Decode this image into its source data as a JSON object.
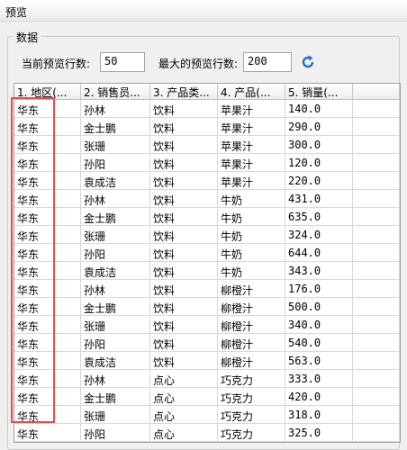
{
  "window": {
    "title": "预览"
  },
  "group": {
    "label": "数据"
  },
  "controls": {
    "current_rows_label": "当前预览行数:",
    "current_rows_value": "50",
    "max_rows_label": "最大的预览行数:",
    "max_rows_value": "200",
    "refresh_icon": "refresh-icon"
  },
  "table": {
    "columns": [
      "1. 地区(...",
      "2. 销售员...",
      "3. 产品类...",
      "4. 产品(...",
      "5. 销量(..."
    ],
    "rows": [
      [
        "华东",
        "孙林",
        "饮料",
        "苹果汁",
        "140.0"
      ],
      [
        "华东",
        "金士鹏",
        "饮料",
        "苹果汁",
        "290.0"
      ],
      [
        "华东",
        "张珊",
        "饮料",
        "苹果汁",
        "300.0"
      ],
      [
        "华东",
        "孙阳",
        "饮料",
        "苹果汁",
        "120.0"
      ],
      [
        "华东",
        "袁成洁",
        "饮料",
        "苹果汁",
        "220.0"
      ],
      [
        "华东",
        "孙林",
        "饮料",
        "牛奶",
        "431.0"
      ],
      [
        "华东",
        "金士鹏",
        "饮料",
        "牛奶",
        "635.0"
      ],
      [
        "华东",
        "张珊",
        "饮料",
        "牛奶",
        "324.0"
      ],
      [
        "华东",
        "孙阳",
        "饮料",
        "牛奶",
        "644.0"
      ],
      [
        "华东",
        "袁成洁",
        "饮料",
        "牛奶",
        "343.0"
      ],
      [
        "华东",
        "孙林",
        "饮料",
        "柳橙汁",
        "176.0"
      ],
      [
        "华东",
        "金士鹏",
        "饮料",
        "柳橙汁",
        "500.0"
      ],
      [
        "华东",
        "张珊",
        "饮料",
        "柳橙汁",
        "340.0"
      ],
      [
        "华东",
        "孙阳",
        "饮料",
        "柳橙汁",
        "540.0"
      ],
      [
        "华东",
        "袁成洁",
        "饮料",
        "柳橙汁",
        "563.0"
      ],
      [
        "华东",
        "孙林",
        "点心",
        "巧克力",
        "333.0"
      ],
      [
        "华东",
        "金士鹏",
        "点心",
        "巧克力",
        "420.0"
      ],
      [
        "华东",
        "张珊",
        "点心",
        "巧克力",
        "318.0"
      ],
      [
        "华东",
        "孙阳",
        "点心",
        "巧克力",
        "325.0"
      ]
    ]
  },
  "colors": {
    "highlight": "#e0504d",
    "accent": "#1e6fc8"
  }
}
